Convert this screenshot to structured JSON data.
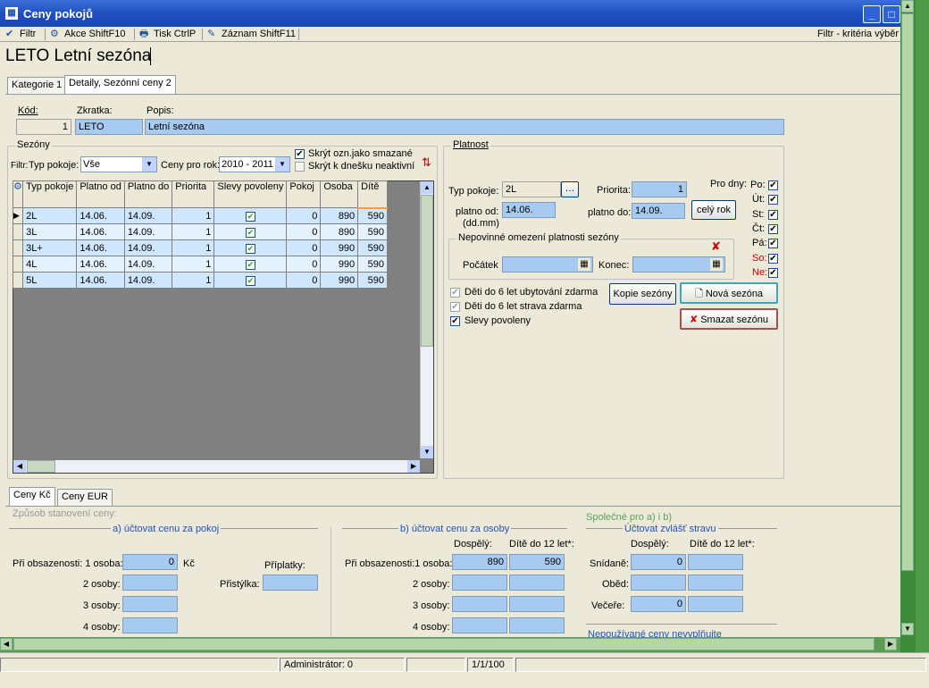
{
  "window": {
    "title": "Ceny pokojů"
  },
  "toolbar": {
    "filter": "Filtr",
    "actions": "Akce ShiftF10",
    "print": "Tisk CtrlP",
    "record": "Záznam ShiftF11",
    "filter_criteria": "Filtr - kritéria výběr"
  },
  "header": {
    "title": "LETO Letní sezóna"
  },
  "tabs": {
    "t1": "Kategorie 1",
    "t2": "Detaily, Sezónní ceny 2"
  },
  "fields": {
    "kod_label": "Kód:",
    "kod_value": "1",
    "zkratka_label": "Zkratka:",
    "zkratka_value": "LETO",
    "popis_label": "Popis:",
    "popis_value": "Letní sezóna"
  },
  "seasons": {
    "caption": "Sezóny",
    "filter_label": "Filtr:",
    "room_type_label": "Typ pokoje:",
    "room_type_value": "Vše",
    "prices_for_year_label": "Ceny pro rok:",
    "year_value": "2010 - 2011",
    "hide_deleted": "Skrýt ozn.jako smazané",
    "hide_inactive": "Skrýt k dnešku neaktivní",
    "columns": [
      "Typ pokoje",
      "Platno od",
      "Platno do",
      "Priorita",
      "Slevy povoleny",
      "Pokoj",
      "Osoba",
      "Dítě"
    ],
    "rows": [
      [
        "2L",
        "14.06.",
        "14.09.",
        "1",
        true,
        "0",
        "890",
        "590"
      ],
      [
        "3L",
        "14.06.",
        "14.09.",
        "1",
        true,
        "0",
        "890",
        "590"
      ],
      [
        "3L+",
        "14.06.",
        "14.09.",
        "1",
        true,
        "0",
        "990",
        "590"
      ],
      [
        "4L",
        "14.06.",
        "14.09.",
        "1",
        true,
        "0",
        "990",
        "590"
      ],
      [
        "5L",
        "14.06.",
        "14.09.",
        "1",
        true,
        "0",
        "990",
        "590"
      ]
    ]
  },
  "validity": {
    "caption": "Platnost",
    "room_type_label": "Typ pokoje:",
    "room_type_value": "2L",
    "priority_label": "Priorita:",
    "priority_value": "1",
    "valid_from_label": "platno od:",
    "valid_from_hint": "(dd.mm)",
    "valid_from_value": "14.06.",
    "valid_to_label": "platno do:",
    "valid_to_value": "14.09.",
    "whole_year": "celý rok",
    "days_label": "Pro dny:",
    "days": [
      "Po:",
      "Út:",
      "St:",
      "Čt:",
      "Pá:",
      "So:",
      "Ne:"
    ],
    "optional_caption": "Nepovinné omezení platnosti sezóny",
    "start_label": "Počátek",
    "end_label": "Konec:",
    "kids_lodging": "Děti do 6 let ubytování zdarma",
    "kids_food": "Děti do 6 let strava zdarma",
    "discounts": "Slevy povoleny",
    "copy_btn": "Kopie sezóny",
    "new_btn": "Nová sezóna",
    "delete_btn": "Smazat sezónu"
  },
  "bottom_tabs": {
    "czk": "Ceny Kč",
    "eur": "Ceny EUR"
  },
  "pricing": {
    "method_label": "Způsob stanovení ceny:",
    "per_room_caption": "a) účtovat cenu za pokoj",
    "per_person_caption": "b) účtovat cenu za osoby",
    "common_label": "Společné pro a) i b)",
    "food_caption": "Účtovat zvlášť stravu",
    "occupancy_label": "Při obsazenosti: 1 osoba:",
    "occupancy_label_b": "Při obsazenosti:1 osoba:",
    "persons": [
      "2 osoby:",
      "3 osoby:",
      "4 osoby:"
    ],
    "room_1_value": "0",
    "currency": "Kč",
    "surcharges": "Příplatky:",
    "extra_bed": "Přistýlka:",
    "adult": "Dospělý:",
    "child": "Dítě do 12 let*:",
    "adult_1_value": "890",
    "child_1_value": "590",
    "breakfast": "Snídaně:",
    "breakfast_value": "0",
    "lunch": "Oběd:",
    "dinner": "Večeře:",
    "dinner_value": "0",
    "note": "Nepoužívané ceny nevyplňujte"
  },
  "status": {
    "user": "Administrátor: 0",
    "record": "1/1/100"
  }
}
